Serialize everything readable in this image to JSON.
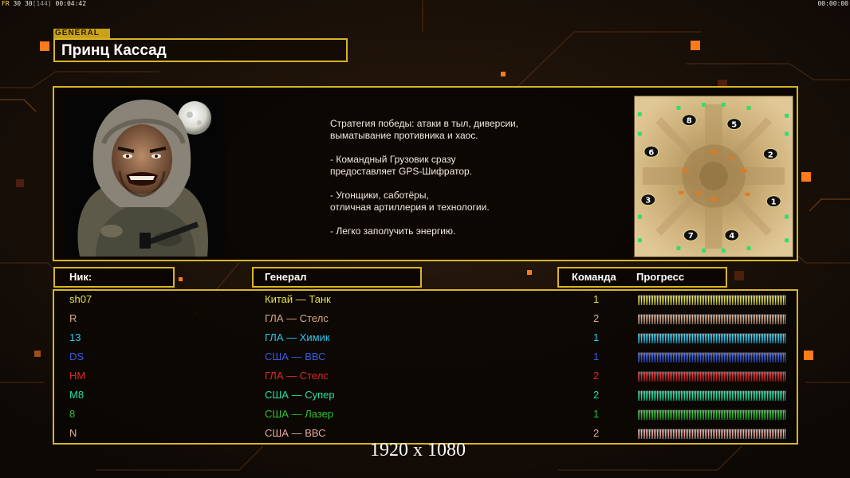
{
  "hud": {
    "fps_label": "FR",
    "fps_value": "30",
    "fps_target": "30",
    "frame_count": "[144]",
    "elapsed_time": "00:04:42",
    "clock_right": "00:00:00"
  },
  "general_tag": "GENERAL",
  "general_name": "Принц Кассад",
  "strategy": [
    "Стратегия победы: атаки в тыл, диверсии,\n выматывание противника и хаос.",
    "- Командный Грузовик сразу\nпредоставляет GPS-Шифратор.",
    "- Угонщики, саботёры,\nотличная артиллерия и технологии.",
    "- Легко заполучить энергию."
  ],
  "minimap": {
    "start_positions": [
      "1",
      "2",
      "3",
      "4",
      "5",
      "6",
      "7",
      "8"
    ]
  },
  "columns": {
    "nick": "Ник:",
    "general": "Генерал",
    "team": "Команда",
    "progress": "Прогресс"
  },
  "players": [
    {
      "nick": "sh07",
      "general": "Китай — Танк",
      "team": "1",
      "color": "#e6e24a",
      "progress": 1.0
    },
    {
      "nick": "R",
      "general": "ГЛА — Стелс",
      "team": "2",
      "color": "#d9a98a",
      "progress": 1.0
    },
    {
      "nick": "13",
      "general": "ГЛА — Химик",
      "team": "1",
      "color": "#2ec8f0",
      "progress": 1.0
    },
    {
      "nick": "DS",
      "general": "США — ВВС",
      "team": "1",
      "color": "#3c5ae0",
      "progress": 1.0
    },
    {
      "nick": "HM",
      "general": "ГЛА — Стелс",
      "team": "2",
      "color": "#e02828",
      "progress": 1.0
    },
    {
      "nick": "M8",
      "general": "США — Супер",
      "team": "2",
      "color": "#1ee0a0",
      "progress": 1.0
    },
    {
      "nick": "8",
      "general": "США — Лазер",
      "team": "1",
      "color": "#30c030",
      "progress": 1.0
    },
    {
      "nick": "N",
      "general": "США — ВВС",
      "team": "2",
      "color": "#e8a8a0",
      "progress": 1.0
    }
  ],
  "resolution_label": "1920 x 1080",
  "colors": {
    "frame": "#d8b524",
    "background": "#120c07",
    "accent_orange": "#ff7a1a"
  }
}
